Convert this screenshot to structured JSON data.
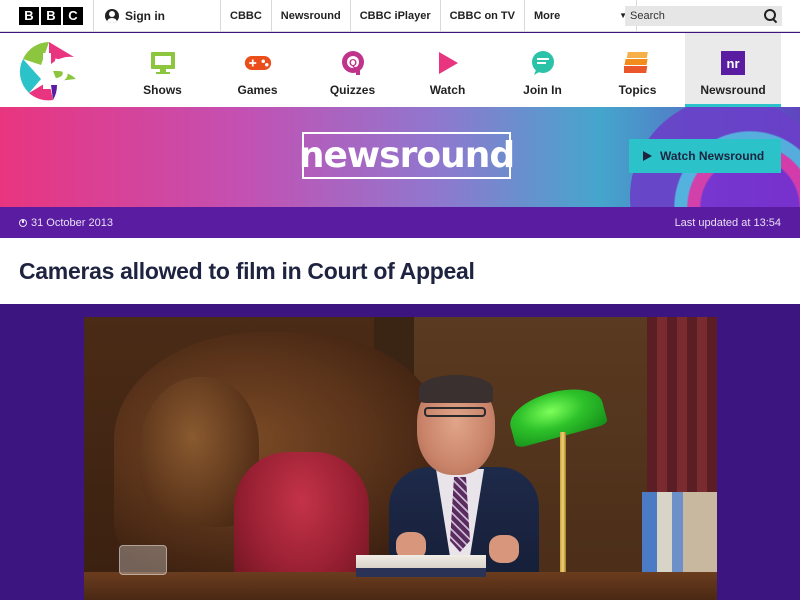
{
  "bbc": {
    "logo_letters": [
      "B",
      "B",
      "C"
    ],
    "signin_label": "Sign in",
    "nav_links": [
      "CBBC",
      "Newsround",
      "CBBC iPlayer",
      "CBBC on TV"
    ],
    "more_label": "More",
    "search_placeholder": "Search"
  },
  "cbbc_nav": {
    "items": [
      {
        "label": "Shows",
        "icon": "tv-icon",
        "color": "#8cc63f"
      },
      {
        "label": "Games",
        "icon": "gamepad-icon",
        "color": "#e94e1b"
      },
      {
        "label": "Quizzes",
        "icon": "quiz-icon",
        "color": "#c0338b"
      },
      {
        "label": "Watch",
        "icon": "play-icon",
        "color": "#e9357f"
      },
      {
        "label": "Join In",
        "icon": "speech-bubble-icon",
        "color": "#2bc3a8"
      },
      {
        "label": "Topics",
        "icon": "layers-icon",
        "color": "#f28c1b"
      },
      {
        "label": "Newsround",
        "icon": "newsround-icon",
        "color": "#5a1da1"
      }
    ],
    "active": "Newsround"
  },
  "banner": {
    "logo_text": "newsround",
    "watch_button": "Watch Newsround"
  },
  "article": {
    "date": "31 October 2013",
    "last_updated": "Last updated at 13:54",
    "headline": "Cameras allowed to film in Court of Appeal"
  },
  "colors": {
    "accent_teal": "#2bc3c9",
    "purple_dark": "#3d1581",
    "purple_bar": "#5a1da1",
    "headline_navy": "#1e2340"
  }
}
